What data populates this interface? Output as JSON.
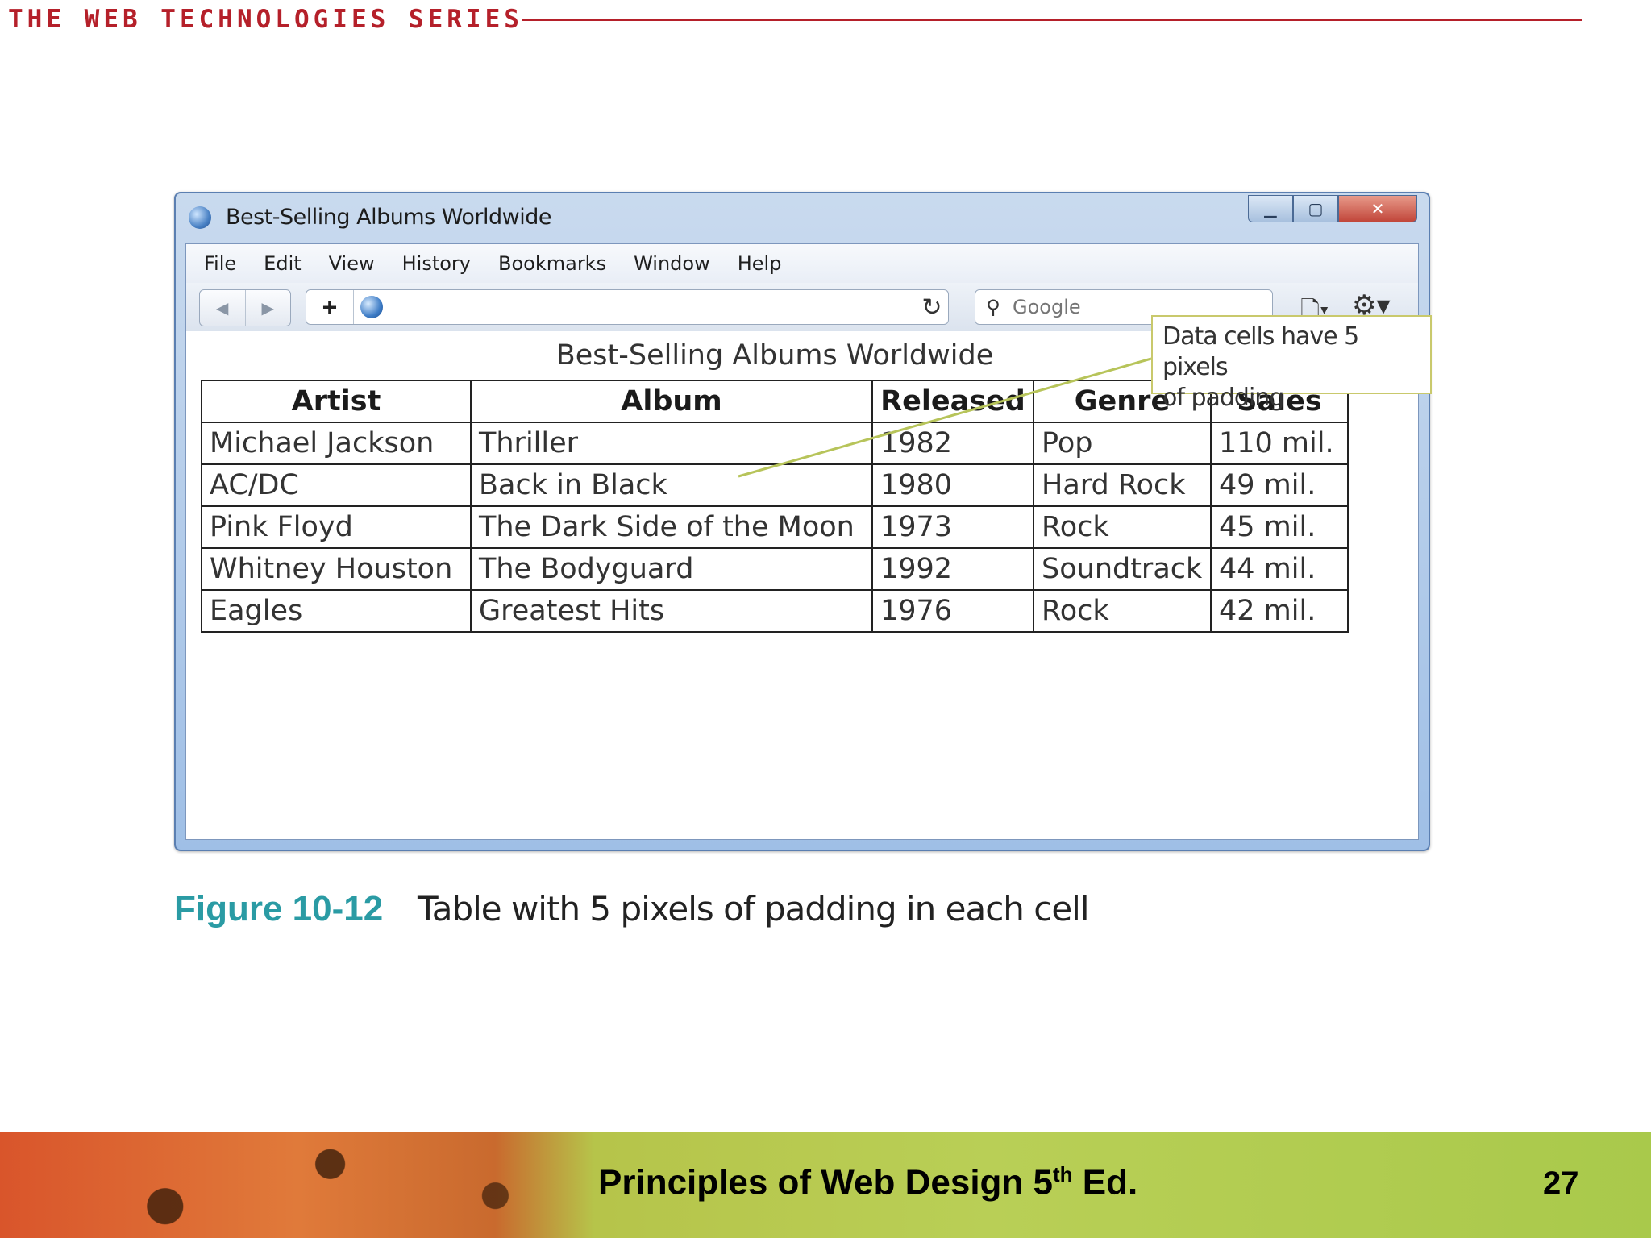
{
  "slide": {
    "series_title": "THE WEB TECHNOLOGIES SERIES",
    "figure_label": "Figure 10-12",
    "figure_caption": "Table with 5 pixels of padding in each cell",
    "footer_title": "Principles of Web Design 5",
    "footer_sup": "th",
    "footer_suffix": " Ed.",
    "page_number": "27",
    "accent_color": "#b5202a",
    "figure_color": "#2a9ba4"
  },
  "browser": {
    "window_title": "Best-Selling Albums Worldwide",
    "menu": [
      "File",
      "Edit",
      "View",
      "History",
      "Bookmarks",
      "Window",
      "Help"
    ],
    "url_value": "",
    "search_placeholder": "Google",
    "icons": {
      "back": "back-arrow-icon",
      "forward": "forward-arrow-icon",
      "add": "plus-icon",
      "site": "globe-icon",
      "reload": "reload-icon",
      "search": "search-icon",
      "page": "page-icon",
      "tools": "gear-icon"
    }
  },
  "table": {
    "caption": "Best-Selling Albums Worldwide",
    "headers": [
      "Artist",
      "Album",
      "Released",
      "Genre",
      "Sales"
    ],
    "rows": [
      [
        "Michael Jackson",
        "Thriller",
        "1982",
        "Pop",
        "110 mil."
      ],
      [
        "AC/DC",
        "Back in Black",
        "1980",
        "Hard Rock",
        "49 mil."
      ],
      [
        "Pink Floyd",
        "The Dark Side of the Moon",
        "1973",
        "Rock",
        "45 mil."
      ],
      [
        "Whitney Houston",
        "The Bodyguard",
        "1992",
        "Soundtrack",
        "44 mil."
      ],
      [
        "Eagles",
        "Greatest Hits",
        "1976",
        "Rock",
        "42 mil."
      ]
    ]
  },
  "callout": {
    "line1": "Data cells have 5 pixels",
    "line2": "of padding"
  }
}
